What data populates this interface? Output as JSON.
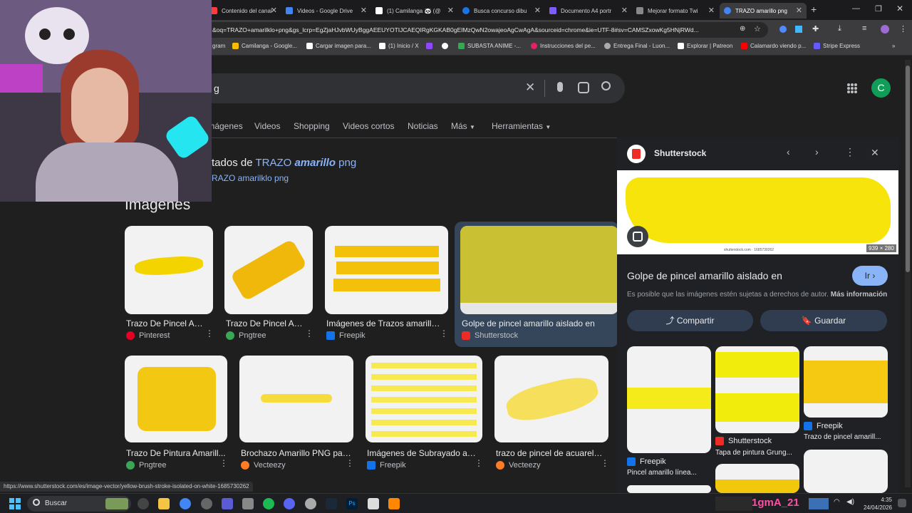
{
  "tabs": [
    {
      "label": "Contenido del canal",
      "color": "#ff3b3b"
    },
    {
      "label": "Videos - Google Drive",
      "color": "#4285f4"
    },
    {
      "label": "(1) Camilanga 🐼 (@",
      "color": "#ffffff"
    },
    {
      "label": "Busca concurso dibu",
      "color": "#1a73e8"
    },
    {
      "label": "Documento A4 portr",
      "color": "#7d5cff"
    },
    {
      "label": "Mejorar formato Twi",
      "color": "#888888"
    },
    {
      "label": "TRAZO amarillo png",
      "color": "#4285f4"
    }
  ],
  "address": "&oq=TRAZO+amarilklo+png&gs_lcrp=EgZjaHJvbWUyBggAEEUYOTIJCAEQIRgKGKAB0gEIMzQwN2owajeoAgCwAgA&sourceid=chrome&ie=UTF-8#sv=CAMSZxowKg5HNjRWd...",
  "bookmarks": [
    {
      "label": "gram",
      "color": "#c13584"
    },
    {
      "label": "Camilanga - Google...",
      "color": "#fbbc04"
    },
    {
      "label": "Cargar imagen para...",
      "color": "#ffffff"
    },
    {
      "label": "(1) Inicio / X",
      "color": "#ffffff"
    },
    {
      "label": "",
      "color": "#ffffff"
    },
    {
      "label": "",
      "color": "#9146ff"
    },
    {
      "label": "SUBASTA ANIME -...",
      "color": "#34a853"
    },
    {
      "label": "Instrucciones del pe...",
      "color": "#e91e63"
    },
    {
      "label": "Entrega Final - Luon...",
      "color": "#aaaaaa"
    },
    {
      "label": "Explorar | Patreon",
      "color": "#ffffff"
    },
    {
      "label": "Calamardo viendo p...",
      "color": "#ff0000"
    },
    {
      "label": "Stripe Express",
      "color": "#635bff"
    }
  ],
  "search": {
    "query_fragment": "g",
    "avatar_letter": "C"
  },
  "nav_tabs": [
    "Imágenes",
    "Videos",
    "Shopping",
    "Videos cortos",
    "Noticias",
    "Más",
    "Herramientas"
  ],
  "results_line": {
    "prefix": "tados de ",
    "query_plain": "TRAZO ",
    "query_italic": "amarillo",
    "query_suffix": " png",
    "alt": "RAZO amarilklo png"
  },
  "section_title": "Imágenes",
  "row1": [
    {
      "title": "Trazo De Pincel Am...",
      "source": "Pinterest",
      "src_color": "#e60023"
    },
    {
      "title": "Trazo De Pincel Am...",
      "source": "Pngtree",
      "src_color": "#3aa757"
    },
    {
      "title": "Imágenes de Trazos amarillos...",
      "source": "Freepik",
      "src_color": "#1273eb"
    },
    {
      "title": "Golpe de pincel amarillo aislado en",
      "source": "Shutterstock",
      "src_color": "#ee2b24"
    }
  ],
  "row2": [
    {
      "title": "Trazo De Pintura Amarill...",
      "source": "Pngtree",
      "src_color": "#3aa757"
    },
    {
      "title": "Brochazo Amarillo PNG par...",
      "source": "Vecteezy",
      "src_color": "#ff7b25"
    },
    {
      "title": "Imágenes de Subrayado am...",
      "source": "Freepik",
      "src_color": "#1273eb"
    },
    {
      "title": "trazo de pincel de acuarela ...",
      "source": "Vecteezy",
      "src_color": "#ff7b25"
    }
  ],
  "panel": {
    "source": "Shutterstock",
    "dims": "939 × 280",
    "title": "Golpe de pincel amarillo aislado en",
    "go": "Ir",
    "copyright": "Es posible que las imágenes estén sujetas a derechos de autor.",
    "more_info": "Más información",
    "share": "Compartir",
    "save": "Guardar",
    "watermark": "shutterstock.com · 1685730262",
    "related": [
      {
        "source": "Freepik",
        "title": "Pincel amarillo línea...",
        "src_color": "#1273eb"
      },
      {
        "source": "Shutterstock",
        "title": "Tapa de pintura Grung...",
        "src_color": "#ee2b24"
      },
      {
        "source": "Freepik",
        "title": "Trazo de pincel amarill...",
        "src_color": "#1273eb"
      }
    ]
  },
  "status_url": "https://www.shutterstock.com/es/image-vector/yellow-brush-stroke-isolated-on-white-1685730262",
  "taskbar": {
    "search": "Buscar",
    "time": "4:35",
    "date": "24/04/2026",
    "overlay": "1gmA_21"
  }
}
